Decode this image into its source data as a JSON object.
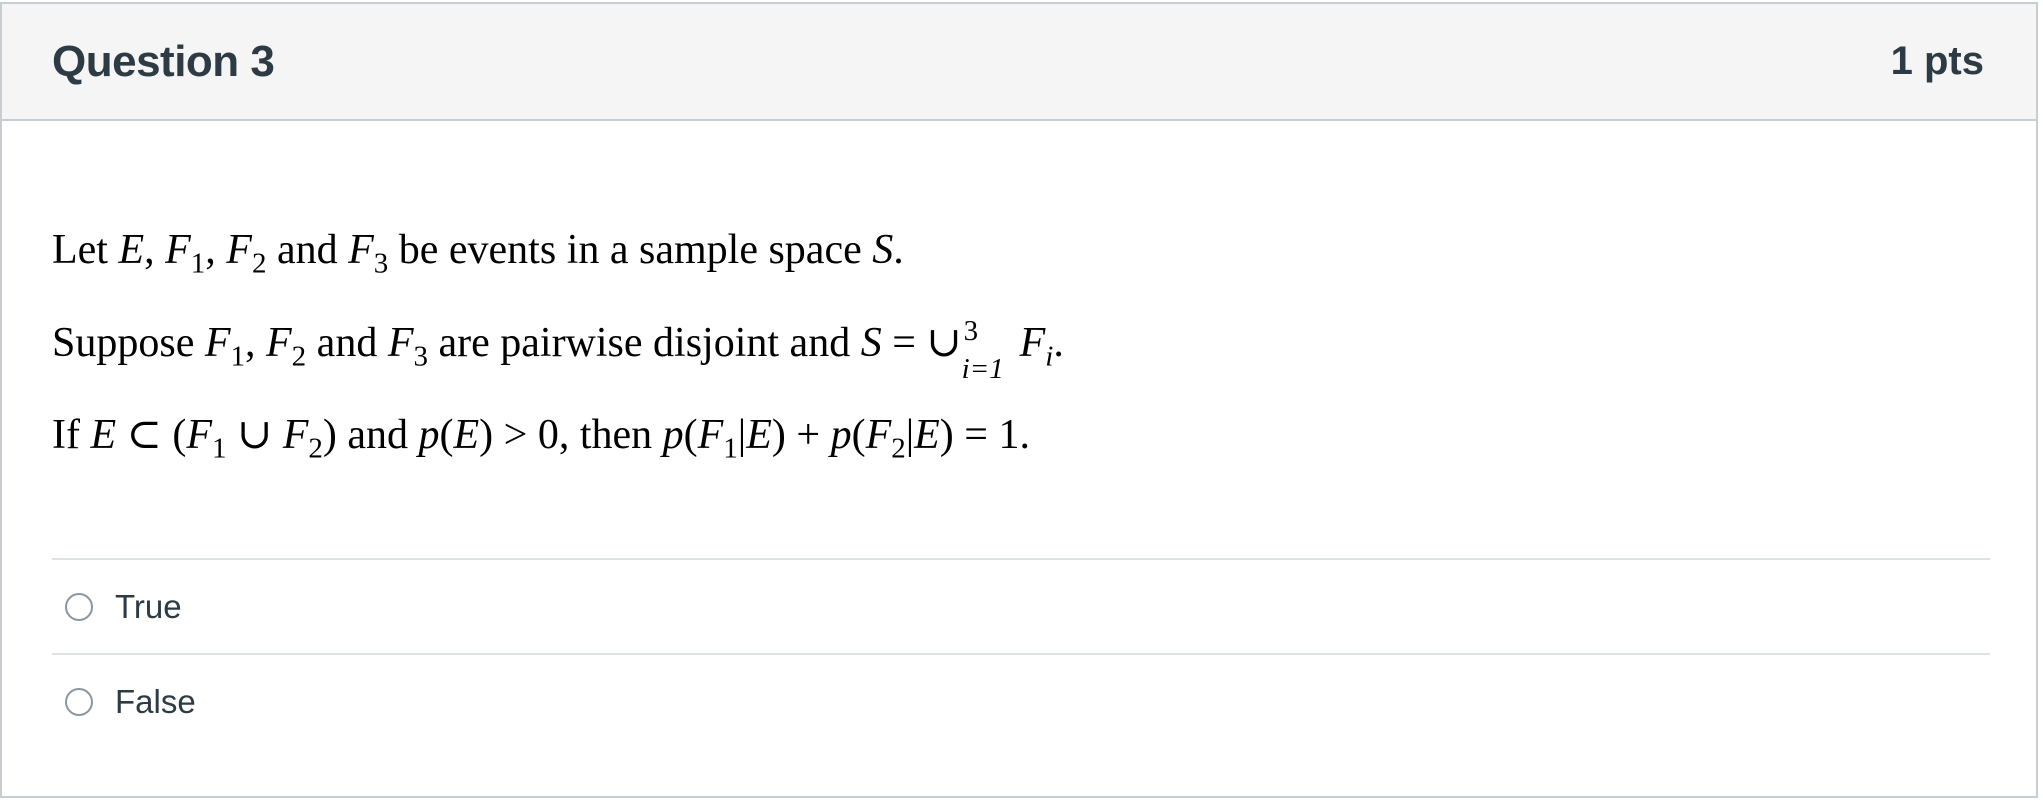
{
  "question": {
    "title": "Question 3",
    "points": "1 pts"
  },
  "statement": {
    "line1": {
      "t1": "Let ",
      "E": "E",
      "c1": ", ",
      "F": "F",
      "s1": "1",
      "c2": ", ",
      "s2": "2",
      "and": " and ",
      "s3": "3",
      "tail": " be events in a sample space ",
      "S": "S",
      "end": "."
    },
    "line2": {
      "t1": "Suppose ",
      "F": "F",
      "s1": "1",
      "c1": ", ",
      "s2": "2",
      "and": " and ",
      "s3": "3",
      "mid": " are pairwise disjoint and ",
      "S": "S",
      "eq": " = ∪",
      "upper": "3",
      "lower": "i=1",
      "Fi": "F",
      "i": "i",
      "end": "."
    },
    "line3": {
      "t1": "If ",
      "E": "E",
      "subset": " ⊂ (",
      "F": "F",
      "s1": "1",
      "union": " ∪ ",
      "s2": "2",
      "close": ")",
      "and": " and ",
      "p": "p",
      "pE": "(",
      "gt": ") > 0, then ",
      "bar": "|",
      "rp": ")",
      "plus": " + ",
      "eq": ") = 1."
    }
  },
  "answers": [
    {
      "label": "True"
    },
    {
      "label": "False"
    }
  ]
}
